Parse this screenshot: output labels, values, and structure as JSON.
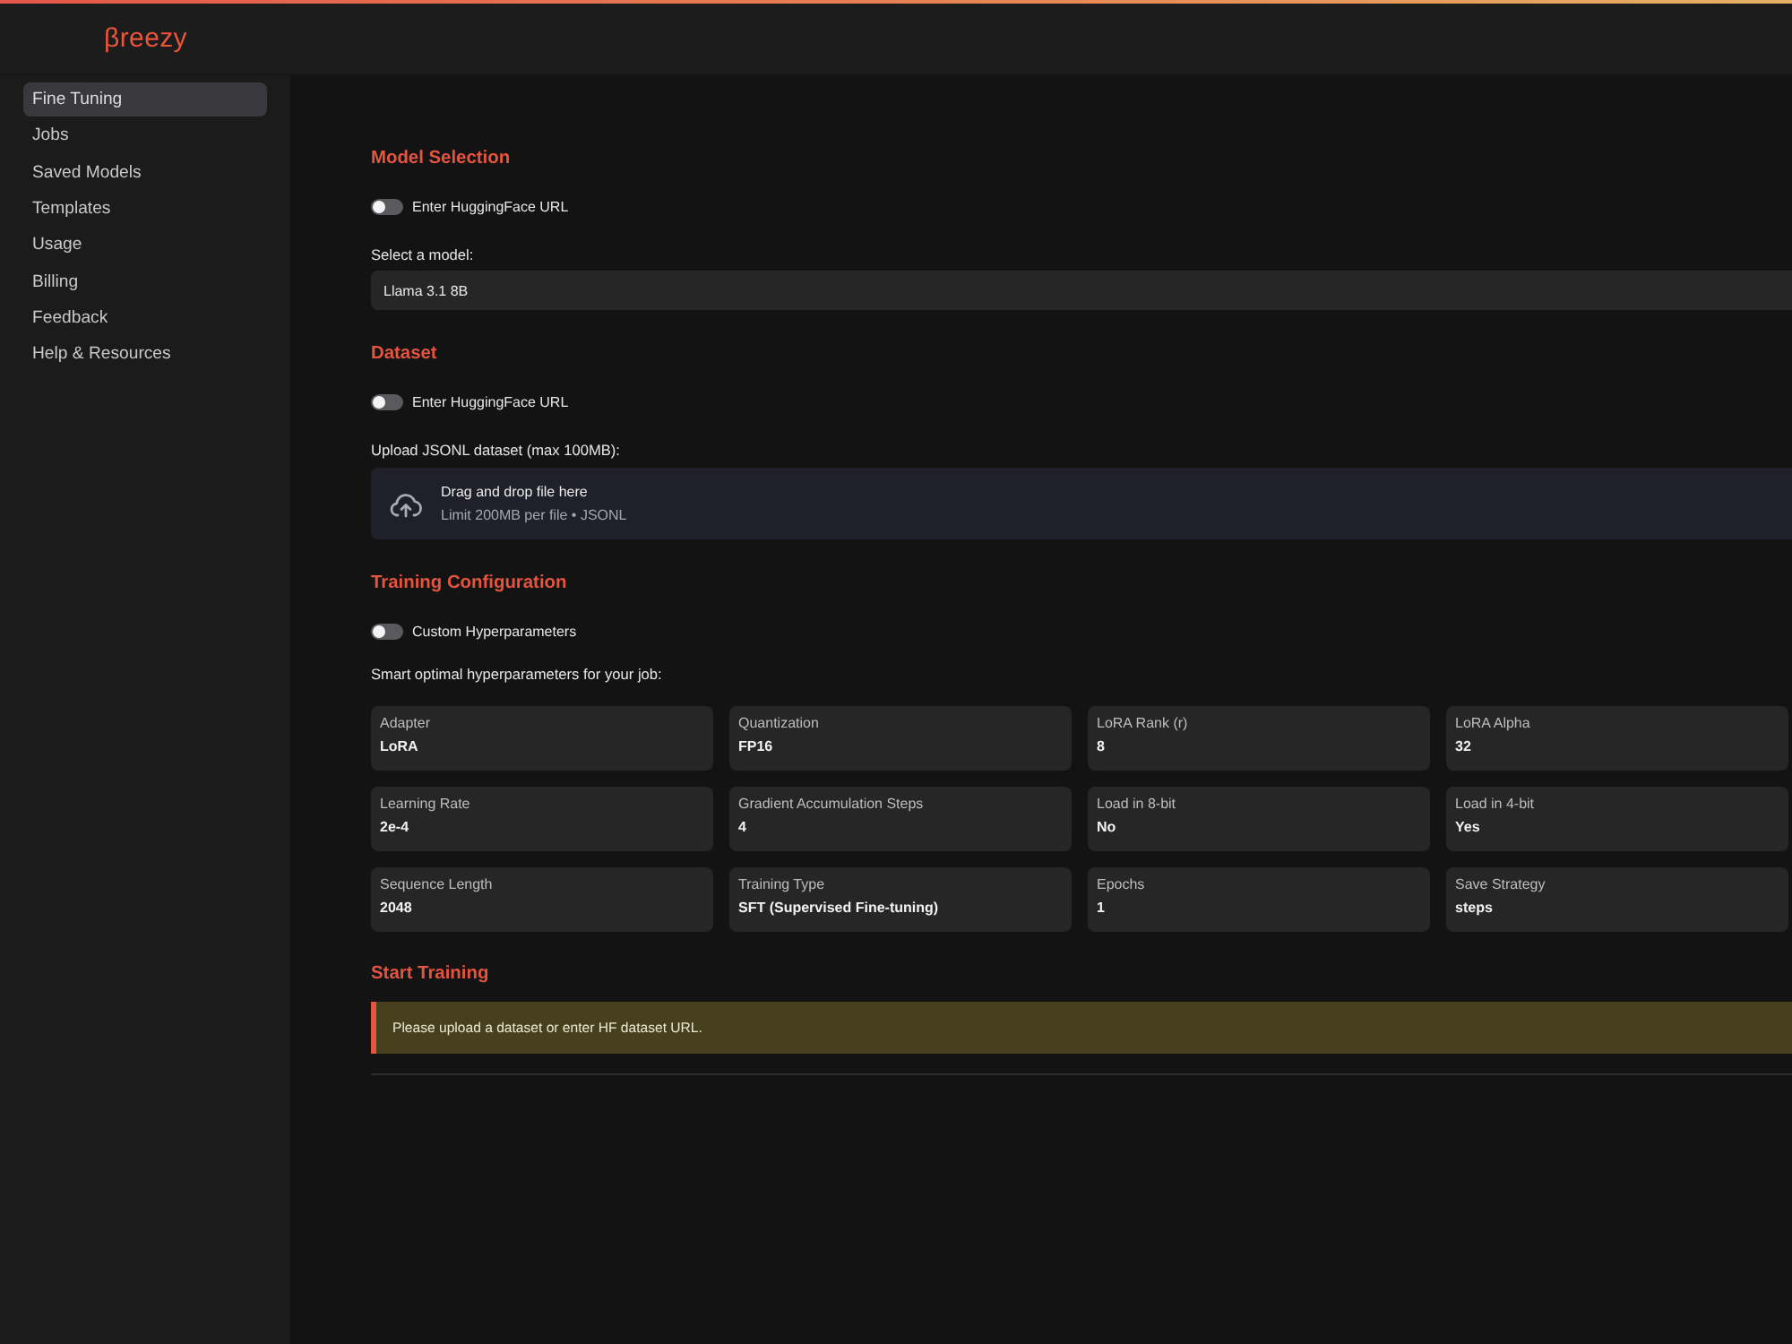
{
  "header": {
    "logo": "βreezy"
  },
  "sidebar": {
    "items": [
      {
        "label": "Fine Tuning",
        "selected": true
      },
      {
        "label": "Jobs",
        "selected": false
      },
      {
        "label": "Saved Models",
        "selected": false
      },
      {
        "label": "Templates",
        "selected": false
      },
      {
        "label": "Usage",
        "selected": false
      },
      {
        "label": "Billing",
        "selected": false
      },
      {
        "label": "Feedback",
        "selected": false
      },
      {
        "label": "Help & Resources",
        "selected": false
      }
    ]
  },
  "model_selection": {
    "title": "Model Selection",
    "toggle": {
      "label": "Enter HuggingFace URL",
      "on": false
    },
    "field_label": "Select a model:",
    "select": {
      "value": "Llama 3.1 8B"
    }
  },
  "dataset": {
    "title": "Dataset",
    "toggle": {
      "label": "Enter HuggingFace URL",
      "on": false
    },
    "field_label": "Upload JSONL dataset (max 100MB):",
    "dropzone": {
      "title": "Drag and drop file here",
      "hint": "Limit 200MB per file • JSONL"
    }
  },
  "training_configuration": {
    "title": "Training Configuration",
    "toggle": {
      "label": "Custom Hyperparameters",
      "on": false
    },
    "caption": "Smart optimal hyperparameters for your job:",
    "params": [
      {
        "label": "Adapter",
        "value": "LoRA"
      },
      {
        "label": "Quantization",
        "value": "FP16"
      },
      {
        "label": "LoRA Rank (r)",
        "value": "8"
      },
      {
        "label": "LoRA Alpha",
        "value": "32"
      },
      {
        "label": "Learning Rate",
        "value": "2e-4"
      },
      {
        "label": "Gradient Accumulation Steps",
        "value": "4"
      },
      {
        "label": "Load in 8-bit",
        "value": "No"
      },
      {
        "label": "Load in 4-bit",
        "value": "Yes"
      },
      {
        "label": "Sequence Length",
        "value": "2048"
      },
      {
        "label": "Training Type",
        "value": "SFT (Supervised Fine-tuning)"
      },
      {
        "label": "Epochs",
        "value": "1"
      },
      {
        "label": "Save Strategy",
        "value": "steps"
      }
    ]
  },
  "start_training": {
    "title": "Start Training",
    "alert": {
      "kind": "warning",
      "text": "Please upload a dataset or enter HF dataset URL."
    }
  }
}
